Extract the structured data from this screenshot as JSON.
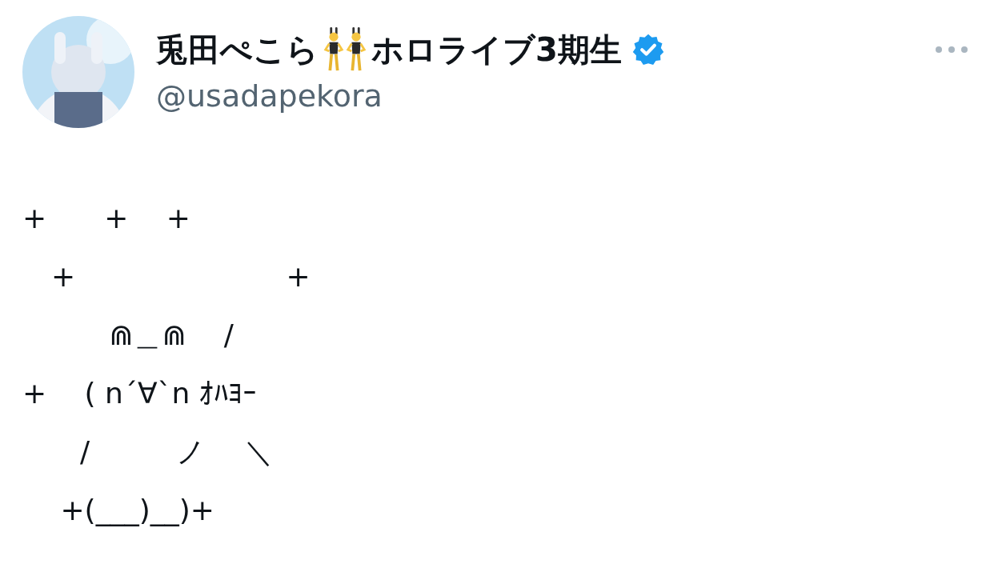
{
  "author": {
    "name_parts": [
      "兎田ぺこら",
      "ホロライブ3期生"
    ],
    "verified": true,
    "handle": "@usadapekora"
  },
  "tweet": {
    "lines": [
      "+　　+　 +",
      "　+　　　　　　　 +",
      "　　　⋒＿⋒　 /",
      "+　 ( n´∀`n ｵﾊﾖｰ",
      "　　/　　　ノ　 ＼",
      "　 +(___)__)+"
    ]
  }
}
